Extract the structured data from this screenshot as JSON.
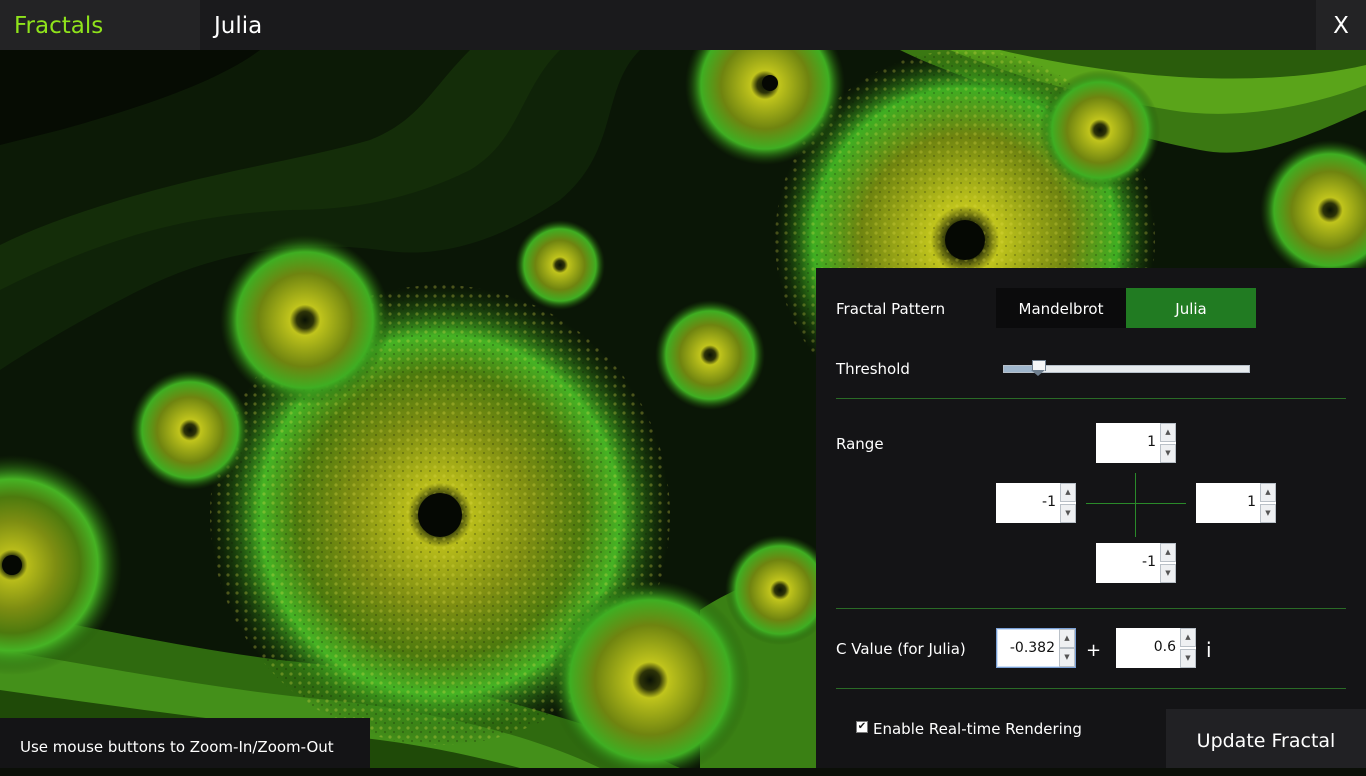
{
  "header": {
    "app_title": "Fractals",
    "mode_title": "Julia",
    "close_label": "X"
  },
  "hint": "Use mouse buttons to Zoom-In/Zoom-Out",
  "panel": {
    "pattern_label": "Fractal Pattern",
    "pattern_options": [
      "Mandelbrot",
      "Julia"
    ],
    "pattern_selected": "Julia",
    "threshold_label": "Threshold",
    "threshold_level": 0.14,
    "range_label": "Range",
    "range": {
      "top": "1",
      "left": "-1",
      "right": "1",
      "bottom": "-1"
    },
    "c_label": "C Value (for Julia)",
    "c_real": "-0.382",
    "plus": "+",
    "c_imag": "0.6",
    "imag_unit": "i",
    "realtime_label": "Enable Real-time Rendering",
    "realtime_checked": true,
    "update_label": "Update Fractal"
  },
  "colors": {
    "accent": "#8fe31b",
    "selected": "#217b22",
    "divider": "#2a6b26"
  }
}
